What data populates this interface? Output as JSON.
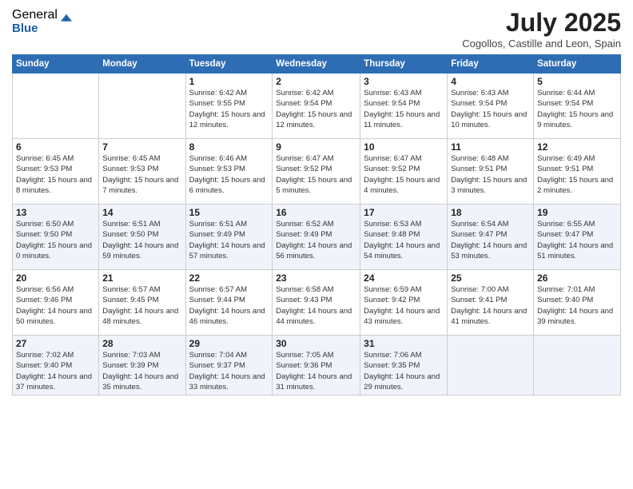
{
  "logo": {
    "general": "General",
    "blue": "Blue"
  },
  "title": "July 2025",
  "subtitle": "Cogollos, Castille and Leon, Spain",
  "days_header": [
    "Sunday",
    "Monday",
    "Tuesday",
    "Wednesday",
    "Thursday",
    "Friday",
    "Saturday"
  ],
  "weeks": [
    [
      {
        "num": "",
        "info": ""
      },
      {
        "num": "",
        "info": ""
      },
      {
        "num": "1",
        "info": "Sunrise: 6:42 AM\nSunset: 9:55 PM\nDaylight: 15 hours and 12 minutes."
      },
      {
        "num": "2",
        "info": "Sunrise: 6:42 AM\nSunset: 9:54 PM\nDaylight: 15 hours and 12 minutes."
      },
      {
        "num": "3",
        "info": "Sunrise: 6:43 AM\nSunset: 9:54 PM\nDaylight: 15 hours and 11 minutes."
      },
      {
        "num": "4",
        "info": "Sunrise: 6:43 AM\nSunset: 9:54 PM\nDaylight: 15 hours and 10 minutes."
      },
      {
        "num": "5",
        "info": "Sunrise: 6:44 AM\nSunset: 9:54 PM\nDaylight: 15 hours and 9 minutes."
      }
    ],
    [
      {
        "num": "6",
        "info": "Sunrise: 6:45 AM\nSunset: 9:53 PM\nDaylight: 15 hours and 8 minutes."
      },
      {
        "num": "7",
        "info": "Sunrise: 6:45 AM\nSunset: 9:53 PM\nDaylight: 15 hours and 7 minutes."
      },
      {
        "num": "8",
        "info": "Sunrise: 6:46 AM\nSunset: 9:53 PM\nDaylight: 15 hours and 6 minutes."
      },
      {
        "num": "9",
        "info": "Sunrise: 6:47 AM\nSunset: 9:52 PM\nDaylight: 15 hours and 5 minutes."
      },
      {
        "num": "10",
        "info": "Sunrise: 6:47 AM\nSunset: 9:52 PM\nDaylight: 15 hours and 4 minutes."
      },
      {
        "num": "11",
        "info": "Sunrise: 6:48 AM\nSunset: 9:51 PM\nDaylight: 15 hours and 3 minutes."
      },
      {
        "num": "12",
        "info": "Sunrise: 6:49 AM\nSunset: 9:51 PM\nDaylight: 15 hours and 2 minutes."
      }
    ],
    [
      {
        "num": "13",
        "info": "Sunrise: 6:50 AM\nSunset: 9:50 PM\nDaylight: 15 hours and 0 minutes."
      },
      {
        "num": "14",
        "info": "Sunrise: 6:51 AM\nSunset: 9:50 PM\nDaylight: 14 hours and 59 minutes."
      },
      {
        "num": "15",
        "info": "Sunrise: 6:51 AM\nSunset: 9:49 PM\nDaylight: 14 hours and 57 minutes."
      },
      {
        "num": "16",
        "info": "Sunrise: 6:52 AM\nSunset: 9:49 PM\nDaylight: 14 hours and 56 minutes."
      },
      {
        "num": "17",
        "info": "Sunrise: 6:53 AM\nSunset: 9:48 PM\nDaylight: 14 hours and 54 minutes."
      },
      {
        "num": "18",
        "info": "Sunrise: 6:54 AM\nSunset: 9:47 PM\nDaylight: 14 hours and 53 minutes."
      },
      {
        "num": "19",
        "info": "Sunrise: 6:55 AM\nSunset: 9:47 PM\nDaylight: 14 hours and 51 minutes."
      }
    ],
    [
      {
        "num": "20",
        "info": "Sunrise: 6:56 AM\nSunset: 9:46 PM\nDaylight: 14 hours and 50 minutes."
      },
      {
        "num": "21",
        "info": "Sunrise: 6:57 AM\nSunset: 9:45 PM\nDaylight: 14 hours and 48 minutes."
      },
      {
        "num": "22",
        "info": "Sunrise: 6:57 AM\nSunset: 9:44 PM\nDaylight: 14 hours and 46 minutes."
      },
      {
        "num": "23",
        "info": "Sunrise: 6:58 AM\nSunset: 9:43 PM\nDaylight: 14 hours and 44 minutes."
      },
      {
        "num": "24",
        "info": "Sunrise: 6:59 AM\nSunset: 9:42 PM\nDaylight: 14 hours and 43 minutes."
      },
      {
        "num": "25",
        "info": "Sunrise: 7:00 AM\nSunset: 9:41 PM\nDaylight: 14 hours and 41 minutes."
      },
      {
        "num": "26",
        "info": "Sunrise: 7:01 AM\nSunset: 9:40 PM\nDaylight: 14 hours and 39 minutes."
      }
    ],
    [
      {
        "num": "27",
        "info": "Sunrise: 7:02 AM\nSunset: 9:40 PM\nDaylight: 14 hours and 37 minutes."
      },
      {
        "num": "28",
        "info": "Sunrise: 7:03 AM\nSunset: 9:39 PM\nDaylight: 14 hours and 35 minutes."
      },
      {
        "num": "29",
        "info": "Sunrise: 7:04 AM\nSunset: 9:37 PM\nDaylight: 14 hours and 33 minutes."
      },
      {
        "num": "30",
        "info": "Sunrise: 7:05 AM\nSunset: 9:36 PM\nDaylight: 14 hours and 31 minutes."
      },
      {
        "num": "31",
        "info": "Sunrise: 7:06 AM\nSunset: 9:35 PM\nDaylight: 14 hours and 29 minutes."
      },
      {
        "num": "",
        "info": ""
      },
      {
        "num": "",
        "info": ""
      }
    ]
  ]
}
